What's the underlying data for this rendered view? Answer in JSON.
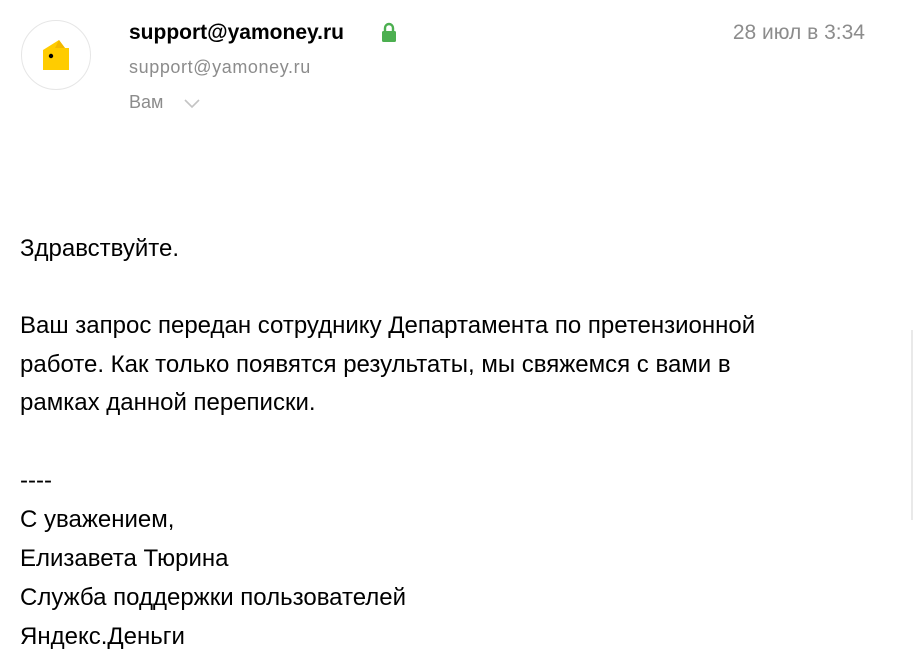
{
  "sender": {
    "name": "support@yamoney.ru",
    "email": "support@yamoney.ru",
    "recipient_label": "Вам",
    "avatar_icon": "yandex-money-wallet-icon",
    "lock_icon": "lock-icon",
    "lock_color": "#4caf50"
  },
  "date": "28 июл в 3:34",
  "message": {
    "greeting": "Здравствуйте.",
    "paragraph_lines": [
      "Ваш запрос передан сотруднику Департамента по претензионной",
      "работе. Как только появятся результаты, мы свяжемся с вами в",
      "рамках данной переписки."
    ],
    "separator": "----",
    "signature": [
      "С уважением,",
      "Елизавета Тюрина",
      "Служба поддержки пользователей",
      "Яндекс.Деньги"
    ]
  },
  "colors": {
    "brand_yellow": "#ffcc00",
    "muted_text": "#8c8c8c"
  }
}
